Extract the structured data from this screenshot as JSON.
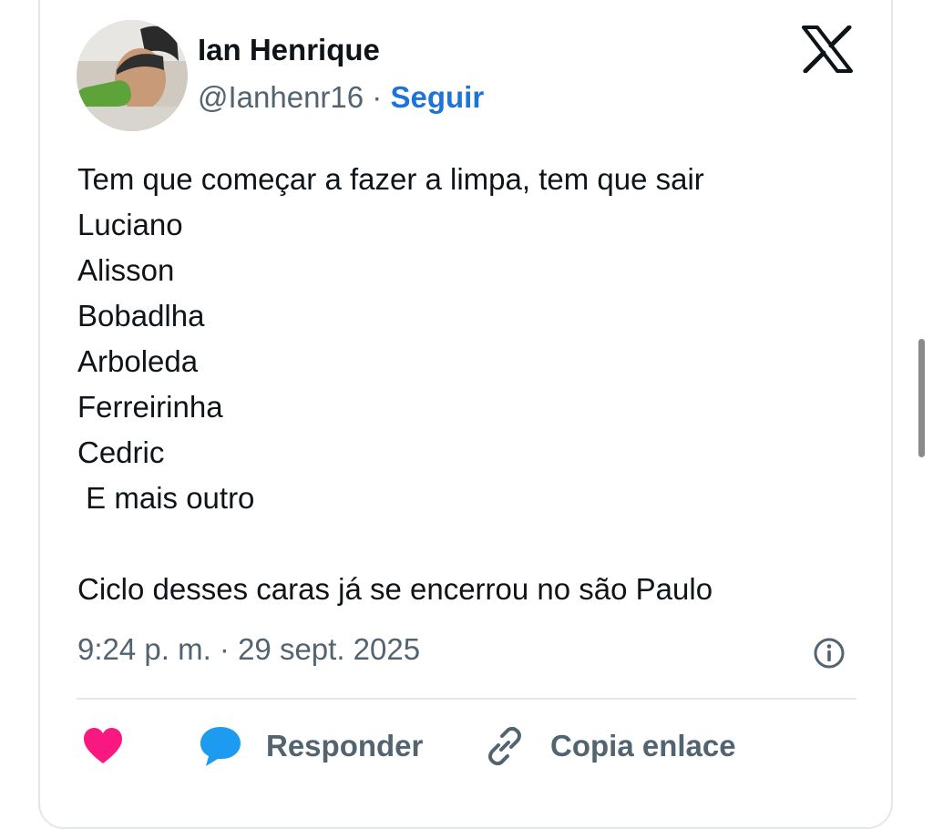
{
  "tweet": {
    "author_name": "Ian Henrique",
    "handle": "@Ianhenr16",
    "separator": " · ",
    "follow_label": "Seguir",
    "text": "Tem que começar a fazer a limpa, tem que sair\nLuciano\nAlisson\nBobadlha\nArboleda\nFerreirinha\nCedric\n E mais outro\n\nCiclo desses caras já se encerrou no são Paulo",
    "timestamp": "9:24 p. m. · 29 sept. 2025"
  },
  "actions": {
    "reply_label": "Responder",
    "copy_link_label": "Copia enlace"
  },
  "icons": {
    "logo": "x-logo-icon",
    "info": "info-icon",
    "like": "heart-icon",
    "reply": "speech-bubble-icon",
    "copy_link": "link-icon"
  },
  "colors": {
    "follow": "#1d74d8",
    "like": "#f91880",
    "reply": "#1d9bf0",
    "secondary_text": "#536471"
  }
}
